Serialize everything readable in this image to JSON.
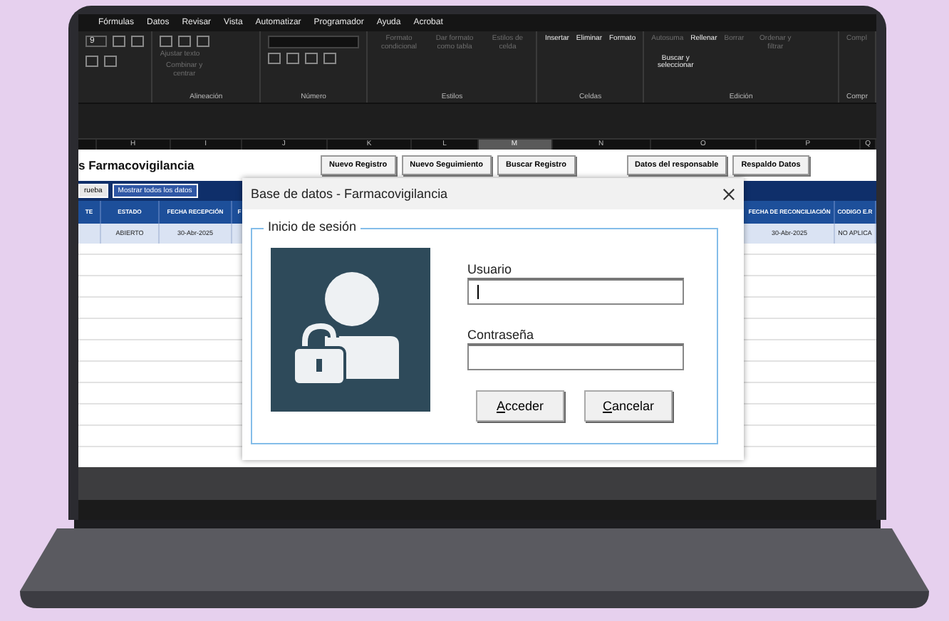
{
  "ribbon": {
    "tabs": [
      {
        "label": "Fórmulas"
      },
      {
        "label": "Datos"
      },
      {
        "label": "Revisar"
      },
      {
        "label": "Vista"
      },
      {
        "label": "Automatizar"
      },
      {
        "label": "Programador"
      },
      {
        "label": "Ayuda"
      },
      {
        "label": "Acrobat"
      }
    ],
    "font_size": "9",
    "groups": [
      {
        "label": "Alineación",
        "commands": [
          {
            "label": "Ajustar texto",
            "disabled": true
          },
          {
            "label": "Combinar y centrar",
            "disabled": true
          }
        ]
      },
      {
        "label": "Número"
      },
      {
        "label": "Estilos",
        "commands": [
          {
            "label": "Formato condicional",
            "disabled": true
          },
          {
            "label": "Dar formato como tabla",
            "disabled": true
          },
          {
            "label": "Estilos de celda",
            "disabled": true
          }
        ]
      },
      {
        "label": "Celdas",
        "commands": [
          {
            "label": "Insertar",
            "disabled": false
          },
          {
            "label": "Eliminar",
            "disabled": false
          },
          {
            "label": "Formato",
            "disabled": false
          }
        ]
      },
      {
        "label": "Edición",
        "commands": [
          {
            "label": "Autosuma",
            "disabled": true
          },
          {
            "label": "Rellenar",
            "disabled": false
          },
          {
            "label": "Borrar",
            "disabled": true
          },
          {
            "label": "Ordenar y filtrar",
            "disabled": true
          },
          {
            "label": "Buscar y seleccionar",
            "disabled": false
          }
        ]
      },
      {
        "label": "Compr",
        "commands": [
          {
            "label": "Compl",
            "disabled": true
          }
        ]
      }
    ]
  },
  "sheet": {
    "columns": [
      {
        "selected": false
      },
      {
        "label": "H",
        "selected": false
      },
      {
        "label": "I",
        "selected": false
      },
      {
        "label": "J",
        "selected": false
      },
      {
        "label": "K",
        "selected": false
      },
      {
        "label": "L",
        "selected": false
      },
      {
        "label": "M",
        "selected": true
      },
      {
        "label": "N",
        "selected": false
      },
      {
        "label": "O",
        "selected": false
      },
      {
        "label": "P",
        "selected": false
      },
      {
        "label": "Q",
        "selected": false
      }
    ],
    "title": "s Farmacovigilancia",
    "buttons": [
      "Nuevo Registro",
      "Nuevo Seguimiento",
      "Buscar Registro",
      "Datos del responsable",
      "Respaldo Datos"
    ],
    "filter_buttons": [
      "rueba",
      "Mostrar todos los datos"
    ],
    "headers_left": [
      "TE",
      "ESTADO",
      "FECHA RECEPCIÓN",
      "F"
    ],
    "headers_right": [
      "FECHA DE RECONCILIACIÓN",
      "CODIGO E.R"
    ],
    "row_left": [
      "ABIERTO",
      "30-Abr-2025"
    ],
    "row_right": [
      "30-Abr-2025",
      "NO APLICA"
    ]
  },
  "dialog": {
    "title": "Base de datos - Farmacovigilancia",
    "legend": "Inicio de sesión",
    "user_label": "Usuario",
    "password_label": "Contraseña",
    "buttons": [
      "Acceder",
      "Cancelar"
    ]
  }
}
